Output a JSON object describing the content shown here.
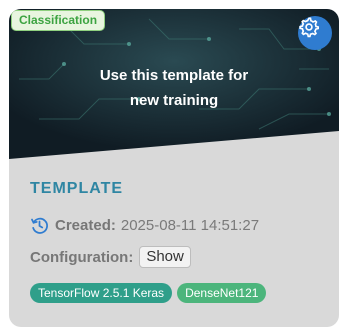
{
  "badge": {
    "label": "Classification",
    "color": "#3ca341"
  },
  "hero": {
    "line1": "Use this template for",
    "line2": "new training",
    "settings_icon": "gear-icon"
  },
  "card": {
    "title": "TEMPLATE",
    "created_label": "Created:",
    "created_value": "2025-08-11 14:51:27",
    "created_icon": "clock-history-icon",
    "config_label": "Configuration:",
    "show_button": "Show"
  },
  "tags": [
    {
      "label": "TensorFlow 2.5.1 Keras",
      "color": "#2f9f8a"
    },
    {
      "label": "DenseNet121",
      "color": "#4cb57c"
    }
  ],
  "colors": {
    "accent": "#2f7cd0",
    "title": "#2f86a3",
    "hero_bg": "#17252f"
  }
}
